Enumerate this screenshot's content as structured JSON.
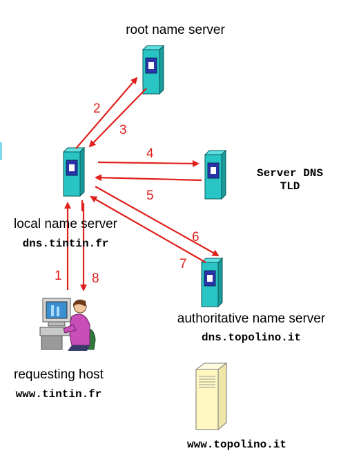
{
  "labels": {
    "root": "root name server",
    "tld_line1": "Server DNS",
    "tld_line2": "TLD",
    "local": "local name server",
    "local_host": "dns.tintin.fr",
    "auth": "authoritative name server",
    "auth_host": "dns.topolino.it",
    "req": "requesting host",
    "req_host": "www.tintin.fr",
    "web_host": "www.topolino.it"
  },
  "steps": [
    "1",
    "2",
    "3",
    "4",
    "5",
    "6",
    "7",
    "8"
  ],
  "colors": {
    "arrow": "#e0201c",
    "server_face": "#29c5c5",
    "server_side": "#1a9a9a",
    "server_top": "#5fe0e0",
    "server_panel": "#2a34a8",
    "web_server": "#fff8c0"
  },
  "icons": {
    "root": "dns-server-icon",
    "tld": "dns-server-icon",
    "local": "dns-server-icon",
    "auth": "dns-server-icon",
    "host": "user-at-computer-icon",
    "web": "web-server-icon"
  }
}
